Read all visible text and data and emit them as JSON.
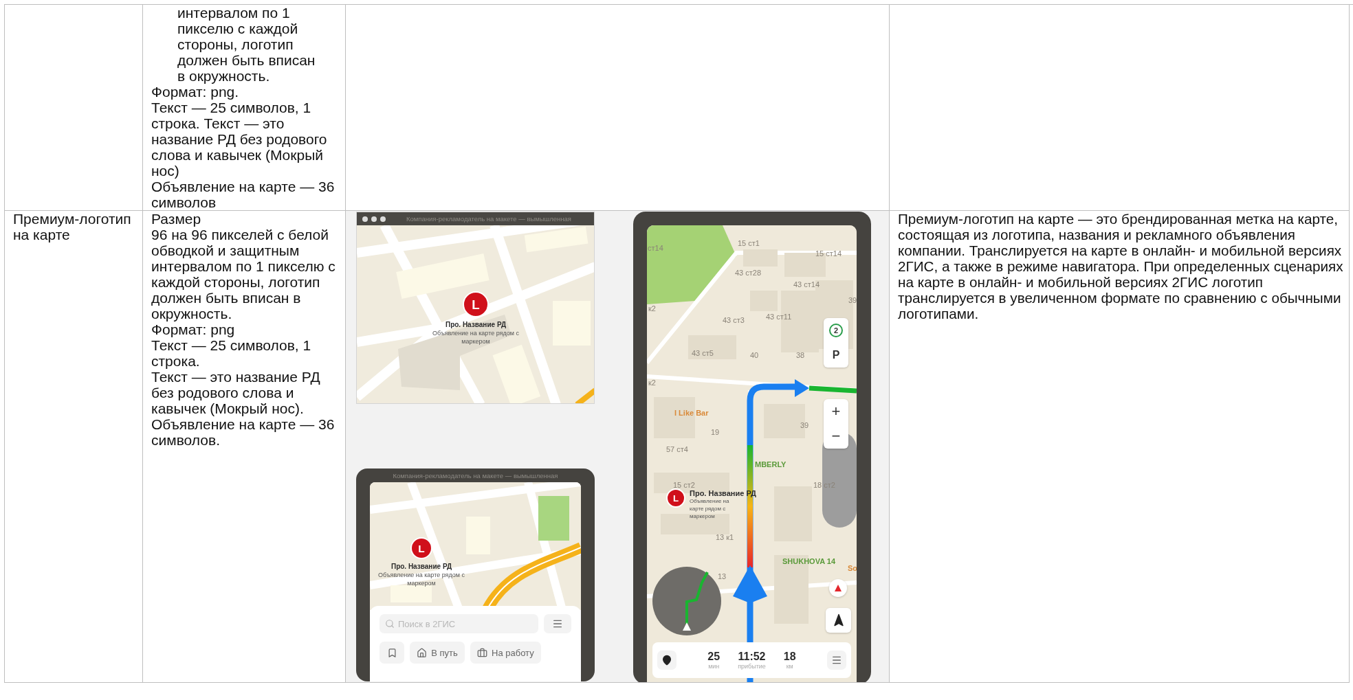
{
  "table": {
    "rows": [
      {
        "requirements": [
          {
            "kind": "indented",
            "text": "интервалом по 1 пикселю с каждой стороны, логотип должен быть вписан в окружность."
          },
          {
            "kind": "plain",
            "text": "Формат: png."
          },
          {
            "kind": "plain",
            "text": "Текст — 25 символов, 1 строка. Текст — это название РД без родового слова и кавычек (Мокрый нос)"
          },
          {
            "kind": "plain",
            "text": "Объявление на карте — 36 символов"
          }
        ]
      },
      {
        "element": "Премиум-логотип на карте",
        "requirements": [
          {
            "kind": "plain",
            "text": "Размер"
          },
          {
            "kind": "plain",
            "text": "96 на 96 пикселей с белой обводкой и защитным интервалом по 1 пикселю с каждой стороны, логотип должен быть вписан в окружность."
          },
          {
            "kind": "plain",
            "text": "Формат: png"
          },
          {
            "kind": "plain",
            "text": "Текст — 25 символов, 1 строка."
          },
          {
            "kind": "plain",
            "text": "Текст — это название РД без родового слова и кавычек (Мокрый нос)."
          },
          {
            "kind": "plain",
            "text": "Объявление на карте — 36 символов."
          }
        ],
        "mockups": {
          "desktop": {
            "title": "Компания-рекламодатель на макете — вымышленная",
            "marker": {
              "letter": "L",
              "name": "Про. Название РД",
              "ad": "Объявление на карте рядом с маркером"
            }
          },
          "tablet": {
            "title": "Компания-рекламодатель на макете — вымышленная",
            "marker": {
              "letter": "L",
              "name": "Про. Название РД",
              "ad": "Объявление на карте рядом с маркером"
            },
            "search_placeholder": "Поиск в 2ГИС",
            "chips": [
              {
                "kind": "home",
                "label": "В путь"
              },
              {
                "kind": "work",
                "label": "На работу"
              }
            ]
          },
          "navigator": {
            "map_labels": [
              {
                "kind": "building",
                "text": "ст14"
              },
              {
                "kind": "building",
                "text": "15 ст1"
              },
              {
                "kind": "building",
                "text": "15 ст14"
              },
              {
                "kind": "building",
                "text": "43 ст28"
              },
              {
                "kind": "building",
                "text": "43 ст14"
              },
              {
                "kind": "building",
                "text": "39"
              },
              {
                "kind": "building",
                "text": "к2"
              },
              {
                "kind": "building",
                "text": "43 ст3"
              },
              {
                "kind": "building",
                "text": "43 ст11"
              },
              {
                "kind": "building",
                "text": "43 ст5"
              },
              {
                "kind": "building",
                "text": "40"
              },
              {
                "kind": "building",
                "text": "38"
              },
              {
                "kind": "building",
                "text": "к2"
              },
              {
                "kind": "place",
                "text": "I Like Bar"
              },
              {
                "kind": "building",
                "text": "39"
              },
              {
                "kind": "building",
                "text": "19"
              },
              {
                "kind": "building",
                "text": "57 ст4"
              },
              {
                "kind": "park",
                "text": "MBERLY"
              },
              {
                "kind": "building",
                "text": "15 ст2"
              },
              {
                "kind": "building",
                "text": "18 ст2"
              },
              {
                "kind": "building",
                "text": "13 к1"
              },
              {
                "kind": "building",
                "text": "13"
              },
              {
                "kind": "park",
                "text": "SHUKHOVA 14"
              },
              {
                "kind": "place",
                "text": "So"
              }
            ],
            "marker": {
              "letter": "L",
              "name": "Про. Название РД",
              "ad": "Объявление на карте рядом с маркером"
            },
            "traffic_score": "2",
            "parking": "P",
            "zoom_in": "+",
            "zoom_out": "−",
            "trip": [
              {
                "value": "25",
                "unit": "мин"
              },
              {
                "value": "11:52",
                "unit": "прибытие"
              },
              {
                "value": "18",
                "unit": "км"
              }
            ]
          }
        },
        "description": "Премиум-логотип на карте — это брендированная метка на карте, состоящая из логотипа, названия и рекламного объявления компании. Транслируется на карте в онлайн- и мобильной версиях 2ГИС, а также в режиме навигатора. При определенных сценариях на карте в онлайн- и мобильной версиях 2ГИС логотип транслируется в увеличенном формате по сравнению с обычными логотипами."
      }
    ]
  }
}
